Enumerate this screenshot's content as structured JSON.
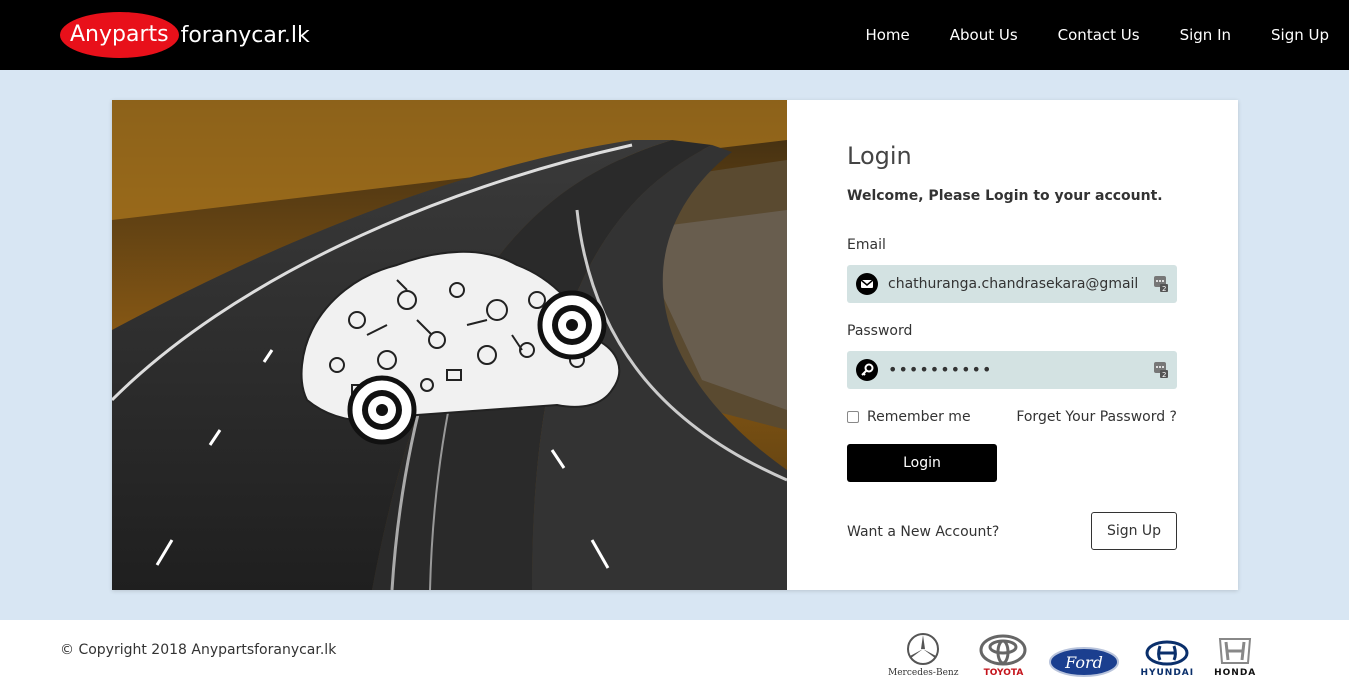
{
  "navbar": {
    "brand_highlight": "Anyparts",
    "brand_rest": "foranycar.lk",
    "links": [
      "Home",
      "About Us",
      "Contact Us",
      "Sign In",
      "Sign Up"
    ]
  },
  "login": {
    "title": "Login",
    "welcome": "Welcome, Please Login to your account.",
    "email_label": "Email",
    "email_value": "chathuranga.chandrasekara@gmail",
    "password_label": "Password",
    "password_value": "••••••••••",
    "remember_label": "Remember me",
    "forgot_label": "Forget Your Password ?",
    "login_button": "Login",
    "new_account_text": "Want a New Account?",
    "signup_button": "Sign Up"
  },
  "footer": {
    "copyright": "© Copyright 2018 Anypartsforanycar.lk",
    "brands": {
      "mercedes": "Mercedes-Benz",
      "toyota": "TOYOTA",
      "ford": "Ford",
      "hyundai": "HYUNDAI",
      "honda": "HONDA"
    }
  },
  "colors": {
    "brand_red": "#e8101a",
    "page_bg": "#d8e6f3",
    "field_bg": "#d3e2e2",
    "ford_blue": "#1b3f8f"
  }
}
